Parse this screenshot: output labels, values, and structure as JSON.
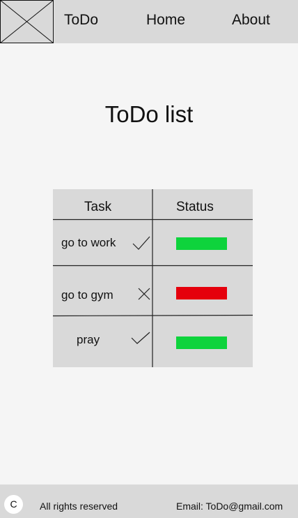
{
  "header": {
    "logo_icon": "image-placeholder-icon",
    "nav": {
      "todo": "ToDo",
      "home": "Home",
      "about": "About"
    }
  },
  "main": {
    "title": "ToDo list",
    "table": {
      "columns": [
        "Task",
        "Status"
      ],
      "rows": [
        {
          "task": "go to work",
          "mark_icon": "check-icon",
          "status_color": "#0ed33c"
        },
        {
          "task": "go to gym",
          "mark_icon": "x-icon",
          "status_color": "#e5000c"
        },
        {
          "task": "pray",
          "mark_icon": "check-icon",
          "status_color": "#0ed33c"
        }
      ]
    }
  },
  "footer": {
    "copyright_symbol": "C",
    "rights": "All rights reserved",
    "email": "Email: ToDo@gmail.com"
  },
  "colors": {
    "background": "#f5f5f5",
    "bar": "#d9d9d9",
    "done": "#0ed33c",
    "not_done": "#e5000c"
  }
}
